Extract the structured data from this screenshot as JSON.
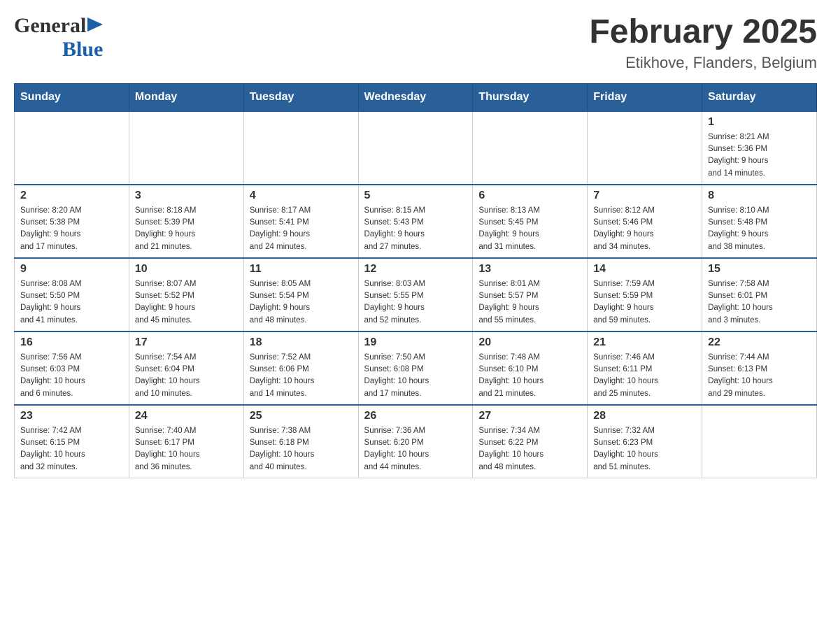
{
  "header": {
    "title": "February 2025",
    "subtitle": "Etikhove, Flanders, Belgium",
    "logo_general": "General",
    "logo_blue": "Blue"
  },
  "days_of_week": [
    "Sunday",
    "Monday",
    "Tuesday",
    "Wednesday",
    "Thursday",
    "Friday",
    "Saturday"
  ],
  "weeks": [
    {
      "days": [
        {
          "number": "",
          "info": ""
        },
        {
          "number": "",
          "info": ""
        },
        {
          "number": "",
          "info": ""
        },
        {
          "number": "",
          "info": ""
        },
        {
          "number": "",
          "info": ""
        },
        {
          "number": "",
          "info": ""
        },
        {
          "number": "1",
          "info": "Sunrise: 8:21 AM\nSunset: 5:36 PM\nDaylight: 9 hours\nand 14 minutes."
        }
      ]
    },
    {
      "days": [
        {
          "number": "2",
          "info": "Sunrise: 8:20 AM\nSunset: 5:38 PM\nDaylight: 9 hours\nand 17 minutes."
        },
        {
          "number": "3",
          "info": "Sunrise: 8:18 AM\nSunset: 5:39 PM\nDaylight: 9 hours\nand 21 minutes."
        },
        {
          "number": "4",
          "info": "Sunrise: 8:17 AM\nSunset: 5:41 PM\nDaylight: 9 hours\nand 24 minutes."
        },
        {
          "number": "5",
          "info": "Sunrise: 8:15 AM\nSunset: 5:43 PM\nDaylight: 9 hours\nand 27 minutes."
        },
        {
          "number": "6",
          "info": "Sunrise: 8:13 AM\nSunset: 5:45 PM\nDaylight: 9 hours\nand 31 minutes."
        },
        {
          "number": "7",
          "info": "Sunrise: 8:12 AM\nSunset: 5:46 PM\nDaylight: 9 hours\nand 34 minutes."
        },
        {
          "number": "8",
          "info": "Sunrise: 8:10 AM\nSunset: 5:48 PM\nDaylight: 9 hours\nand 38 minutes."
        }
      ]
    },
    {
      "days": [
        {
          "number": "9",
          "info": "Sunrise: 8:08 AM\nSunset: 5:50 PM\nDaylight: 9 hours\nand 41 minutes."
        },
        {
          "number": "10",
          "info": "Sunrise: 8:07 AM\nSunset: 5:52 PM\nDaylight: 9 hours\nand 45 minutes."
        },
        {
          "number": "11",
          "info": "Sunrise: 8:05 AM\nSunset: 5:54 PM\nDaylight: 9 hours\nand 48 minutes."
        },
        {
          "number": "12",
          "info": "Sunrise: 8:03 AM\nSunset: 5:55 PM\nDaylight: 9 hours\nand 52 minutes."
        },
        {
          "number": "13",
          "info": "Sunrise: 8:01 AM\nSunset: 5:57 PM\nDaylight: 9 hours\nand 55 minutes."
        },
        {
          "number": "14",
          "info": "Sunrise: 7:59 AM\nSunset: 5:59 PM\nDaylight: 9 hours\nand 59 minutes."
        },
        {
          "number": "15",
          "info": "Sunrise: 7:58 AM\nSunset: 6:01 PM\nDaylight: 10 hours\nand 3 minutes."
        }
      ]
    },
    {
      "days": [
        {
          "number": "16",
          "info": "Sunrise: 7:56 AM\nSunset: 6:03 PM\nDaylight: 10 hours\nand 6 minutes."
        },
        {
          "number": "17",
          "info": "Sunrise: 7:54 AM\nSunset: 6:04 PM\nDaylight: 10 hours\nand 10 minutes."
        },
        {
          "number": "18",
          "info": "Sunrise: 7:52 AM\nSunset: 6:06 PM\nDaylight: 10 hours\nand 14 minutes."
        },
        {
          "number": "19",
          "info": "Sunrise: 7:50 AM\nSunset: 6:08 PM\nDaylight: 10 hours\nand 17 minutes."
        },
        {
          "number": "20",
          "info": "Sunrise: 7:48 AM\nSunset: 6:10 PM\nDaylight: 10 hours\nand 21 minutes."
        },
        {
          "number": "21",
          "info": "Sunrise: 7:46 AM\nSunset: 6:11 PM\nDaylight: 10 hours\nand 25 minutes."
        },
        {
          "number": "22",
          "info": "Sunrise: 7:44 AM\nSunset: 6:13 PM\nDaylight: 10 hours\nand 29 minutes."
        }
      ]
    },
    {
      "days": [
        {
          "number": "23",
          "info": "Sunrise: 7:42 AM\nSunset: 6:15 PM\nDaylight: 10 hours\nand 32 minutes."
        },
        {
          "number": "24",
          "info": "Sunrise: 7:40 AM\nSunset: 6:17 PM\nDaylight: 10 hours\nand 36 minutes."
        },
        {
          "number": "25",
          "info": "Sunrise: 7:38 AM\nSunset: 6:18 PM\nDaylight: 10 hours\nand 40 minutes."
        },
        {
          "number": "26",
          "info": "Sunrise: 7:36 AM\nSunset: 6:20 PM\nDaylight: 10 hours\nand 44 minutes."
        },
        {
          "number": "27",
          "info": "Sunrise: 7:34 AM\nSunset: 6:22 PM\nDaylight: 10 hours\nand 48 minutes."
        },
        {
          "number": "28",
          "info": "Sunrise: 7:32 AM\nSunset: 6:23 PM\nDaylight: 10 hours\nand 51 minutes."
        },
        {
          "number": "",
          "info": ""
        }
      ]
    }
  ]
}
